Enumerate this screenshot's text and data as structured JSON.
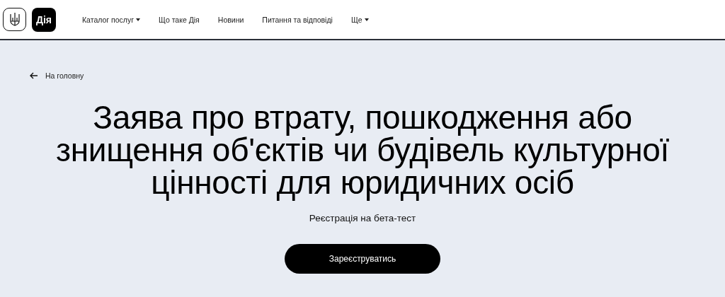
{
  "header": {
    "logo_text": "Дія",
    "nav": [
      {
        "label": "Каталог послуг",
        "has_menu": true
      },
      {
        "label": "Що таке Дія",
        "has_menu": false
      },
      {
        "label": "Новини",
        "has_menu": false
      },
      {
        "label": "Питання та відповіді",
        "has_menu": false
      },
      {
        "label": "Ще",
        "has_menu": true
      }
    ]
  },
  "back_link": "На головну",
  "title_lines": [
    "Заява про втрату, пошкодження або",
    "знищення об'єктів чи будівель культурної",
    "цінності для юридичних осіб"
  ],
  "subtitle": "Реєстрація на бета-тест",
  "button": "Зареєструватись"
}
